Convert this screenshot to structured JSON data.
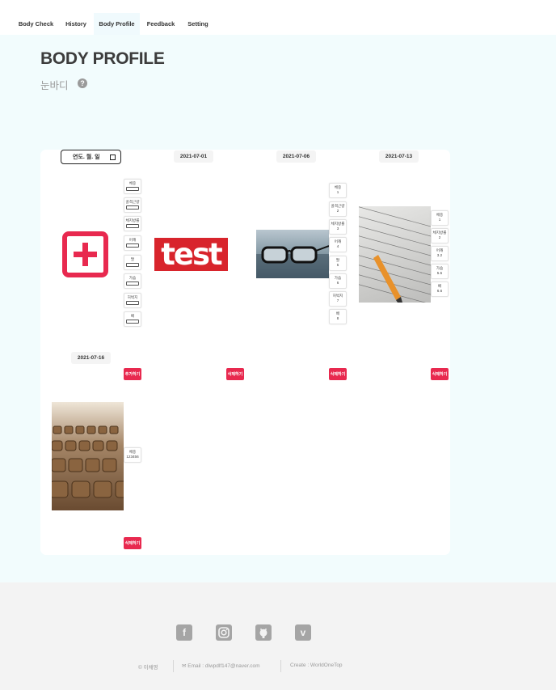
{
  "nav": {
    "tabs": [
      {
        "label": "Body Check"
      },
      {
        "label": "History"
      },
      {
        "label": "Body Profile"
      },
      {
        "label": "Feedback"
      },
      {
        "label": "Setting"
      }
    ],
    "active": "Body Profile"
  },
  "page": {
    "title": "BODY PROFILE",
    "subtitle": "눈바디",
    "help_icon": "question-circle-icon"
  },
  "new_entry": {
    "date_placeholder": "연도. 월. 일",
    "fields": [
      "체중",
      "골격근량",
      "체지방률",
      "어깨",
      "팔",
      "가슴",
      "허벅지",
      "배"
    ],
    "add_button": "추가하기",
    "add_icon": "plus-square-icon"
  },
  "entries": [
    {
      "date": "2021-07-01",
      "image": "test-image",
      "image_text": "test",
      "fields": [],
      "delete_button": "삭제하기"
    },
    {
      "date": "2021-07-06",
      "image": "glasses-image",
      "fields": [
        {
          "label": "체중",
          "value": "1"
        },
        {
          "label": "골격근량",
          "value": "2"
        },
        {
          "label": "체지방률",
          "value": "3"
        },
        {
          "label": "어깨",
          "value": "4"
        },
        {
          "label": "팔",
          "value": "5"
        },
        {
          "label": "가슴",
          "value": "6"
        },
        {
          "label": "허벅지",
          "value": "7"
        },
        {
          "label": "배",
          "value": "8"
        }
      ],
      "delete_button": "삭제하기"
    },
    {
      "date": "2021-07-13",
      "image": "test-paper-image",
      "fields": [
        {
          "label": "체중",
          "value": "1"
        },
        {
          "label": "체지방률",
          "value": "2"
        },
        {
          "label": "어깨",
          "value": "3.2"
        },
        {
          "label": "가슴",
          "value": "5.5"
        },
        {
          "label": "배",
          "value": "6.6"
        }
      ],
      "delete_button": "삭제하기"
    },
    {
      "date": "2021-07-16",
      "image": "seats-image",
      "fields": [
        {
          "label": "체중",
          "value": "123456"
        }
      ],
      "delete_button": "삭제하기"
    }
  ],
  "footer": {
    "social": [
      "facebook-icon",
      "instagram-icon",
      "github-icon",
      "vimeo-icon"
    ],
    "copyright": "© 이채영",
    "email": "✉ Email : dlwpdlf147@naver.com",
    "create": "Create : WorldOneTop"
  },
  "colors": {
    "accent": "#e8294f",
    "page_bg": "#f2fcfd",
    "footer_bg": "#f3f3f3"
  }
}
